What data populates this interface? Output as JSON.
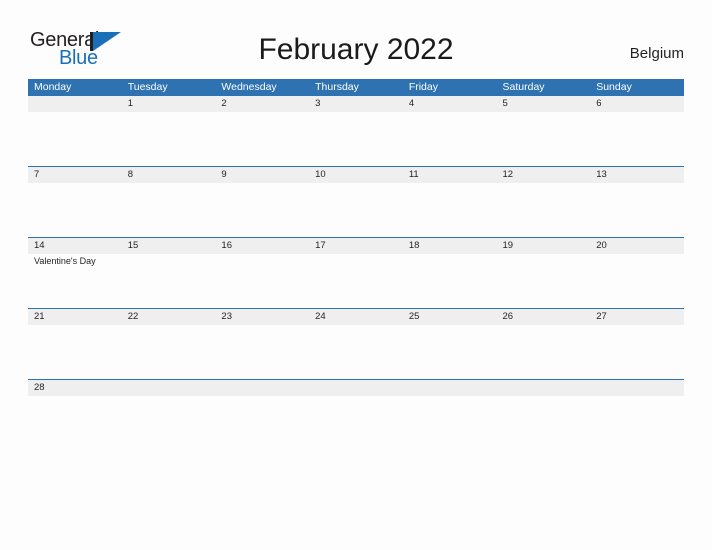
{
  "brand": {
    "name_part1": "General",
    "name_part2": "Blue",
    "logo_icon": "blue-triangle-flag-icon",
    "color_dark": "#231f20",
    "color_blue": "#1a70b8"
  },
  "header": {
    "title": "February 2022",
    "locale": "Belgium"
  },
  "theme": {
    "header_blue": "#2e72b2",
    "row_rule_blue": "#2e72b2",
    "daynum_band_gray": "#efefef",
    "page_background": "#fdfdfd",
    "text_dark": "#231f20"
  },
  "calendar": {
    "month": "February",
    "year": "2022",
    "weekdays": [
      "Monday",
      "Tuesday",
      "Wednesday",
      "Thursday",
      "Friday",
      "Saturday",
      "Sunday"
    ],
    "weeks": [
      [
        {
          "day": "",
          "event": ""
        },
        {
          "day": "1",
          "event": ""
        },
        {
          "day": "2",
          "event": ""
        },
        {
          "day": "3",
          "event": ""
        },
        {
          "day": "4",
          "event": ""
        },
        {
          "day": "5",
          "event": ""
        },
        {
          "day": "6",
          "event": ""
        }
      ],
      [
        {
          "day": "7",
          "event": ""
        },
        {
          "day": "8",
          "event": ""
        },
        {
          "day": "9",
          "event": ""
        },
        {
          "day": "10",
          "event": ""
        },
        {
          "day": "11",
          "event": ""
        },
        {
          "day": "12",
          "event": ""
        },
        {
          "day": "13",
          "event": ""
        }
      ],
      [
        {
          "day": "14",
          "event": "Valentine's Day"
        },
        {
          "day": "15",
          "event": ""
        },
        {
          "day": "16",
          "event": ""
        },
        {
          "day": "17",
          "event": ""
        },
        {
          "day": "18",
          "event": ""
        },
        {
          "day": "19",
          "event": ""
        },
        {
          "day": "20",
          "event": ""
        }
      ],
      [
        {
          "day": "21",
          "event": ""
        },
        {
          "day": "22",
          "event": ""
        },
        {
          "day": "23",
          "event": ""
        },
        {
          "day": "24",
          "event": ""
        },
        {
          "day": "25",
          "event": ""
        },
        {
          "day": "26",
          "event": ""
        },
        {
          "day": "27",
          "event": ""
        }
      ],
      [
        {
          "day": "28",
          "event": ""
        },
        {
          "day": "",
          "event": ""
        },
        {
          "day": "",
          "event": ""
        },
        {
          "day": "",
          "event": ""
        },
        {
          "day": "",
          "event": ""
        },
        {
          "day": "",
          "event": ""
        },
        {
          "day": "",
          "event": ""
        }
      ]
    ]
  }
}
